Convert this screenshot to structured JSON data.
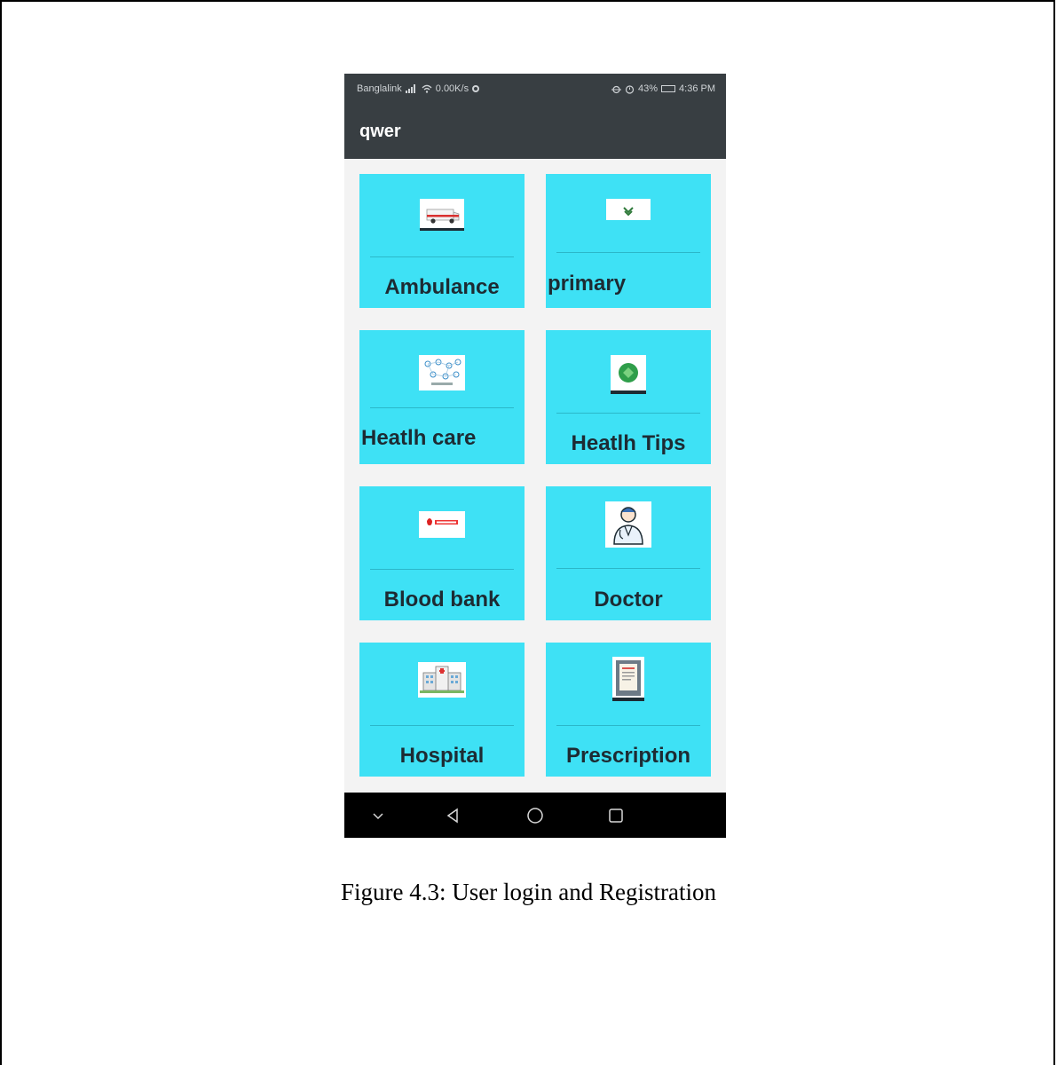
{
  "status_bar": {
    "carrier": "Banglalink",
    "net_speed": "0.00K/s",
    "battery": "43%",
    "time": "4:36 PM"
  },
  "app_bar": {
    "title": "qwer"
  },
  "tiles": [
    {
      "label": "Ambulance",
      "icon": "ambulance-icon"
    },
    {
      "label": "primary",
      "icon": "first-aid-icon"
    },
    {
      "label": "Heatlh care",
      "icon": "healthcare-network-icon"
    },
    {
      "label": "Heatlh Tips",
      "icon": "health-tips-icon"
    },
    {
      "label": "Blood bank",
      "icon": "blood-bank-icon"
    },
    {
      "label": "Doctor",
      "icon": "doctor-icon"
    },
    {
      "label": "Hospital",
      "icon": "hospital-icon"
    },
    {
      "label": "Prescription",
      "icon": "prescription-icon"
    }
  ],
  "caption": "Figure 4.3: User login and Registration",
  "colors": {
    "tile": "#3ee1f5",
    "app_bar": "#383e42",
    "nav_bar": "#000000",
    "background": "#f3f3f3"
  }
}
